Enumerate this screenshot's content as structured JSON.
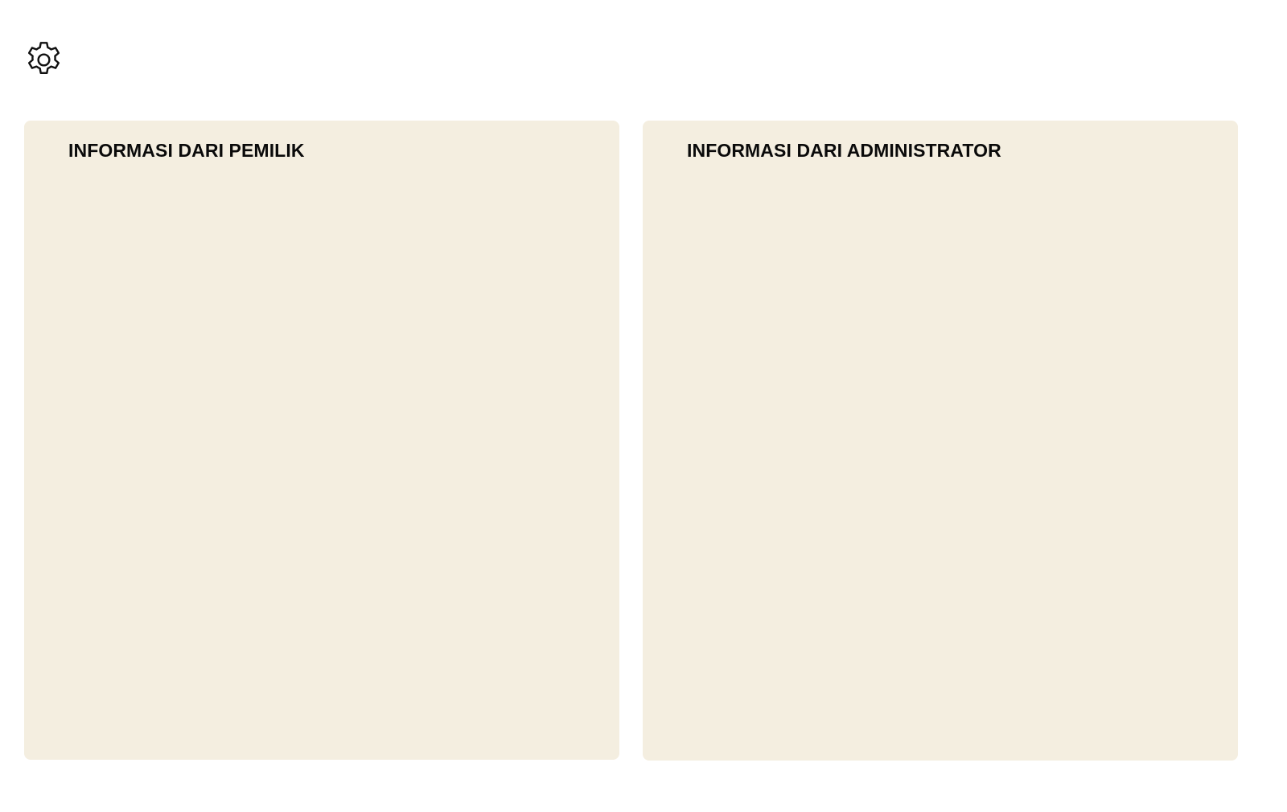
{
  "header": {
    "settings_icon": "gear-icon"
  },
  "panels": {
    "owner": {
      "title": "INFORMASI DARI PEMILIK"
    },
    "admin": {
      "title": "INFORMASI DARI ADMINISTRATOR"
    }
  },
  "colors": {
    "panel_background": "#f4eee0",
    "title_text": "#0a0a0a",
    "page_background": "#ffffff"
  }
}
